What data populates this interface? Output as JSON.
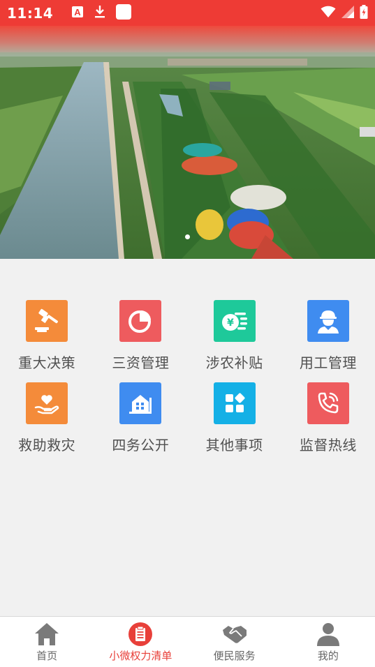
{
  "status_bar": {
    "time": "11:14",
    "background": "#ee3b35",
    "left_icons": [
      "text-a-icon",
      "download-icon",
      "app-square-icon"
    ],
    "right_icons": [
      "wifi-icon",
      "signal-icon",
      "battery-charging-icon"
    ]
  },
  "banner": {
    "slide_count": 1,
    "active_slide": 0
  },
  "menu": {
    "items": [
      {
        "label": "重大决策",
        "icon": "gavel-icon",
        "color": "#f48b3a"
      },
      {
        "label": "三资管理",
        "icon": "pie-chart-icon",
        "color": "#ee5b5e"
      },
      {
        "label": "涉农补贴",
        "icon": "coins-icon",
        "color": "#1ec99a"
      },
      {
        "label": "用工管理",
        "icon": "worker-icon",
        "color": "#3f8cf0"
      },
      {
        "label": "救助救灾",
        "icon": "heart-hand-icon",
        "color": "#f48b3a"
      },
      {
        "label": "四务公开",
        "icon": "building-icon",
        "color": "#3f8cf0"
      },
      {
        "label": "其他事项",
        "icon": "apps-grid-icon",
        "color": "#14b0e6"
      },
      {
        "label": "监督热线",
        "icon": "phone-call-icon",
        "color": "#ee5b5e"
      }
    ]
  },
  "bottom_nav": {
    "active_color": "#e8403a",
    "items": [
      {
        "label": "首页",
        "icon": "home-icon"
      },
      {
        "label": "小微权力清单",
        "icon": "clipboard-list-icon"
      },
      {
        "label": "便民服务",
        "icon": "handshake-icon"
      },
      {
        "label": "我的",
        "icon": "user-icon"
      }
    ]
  }
}
